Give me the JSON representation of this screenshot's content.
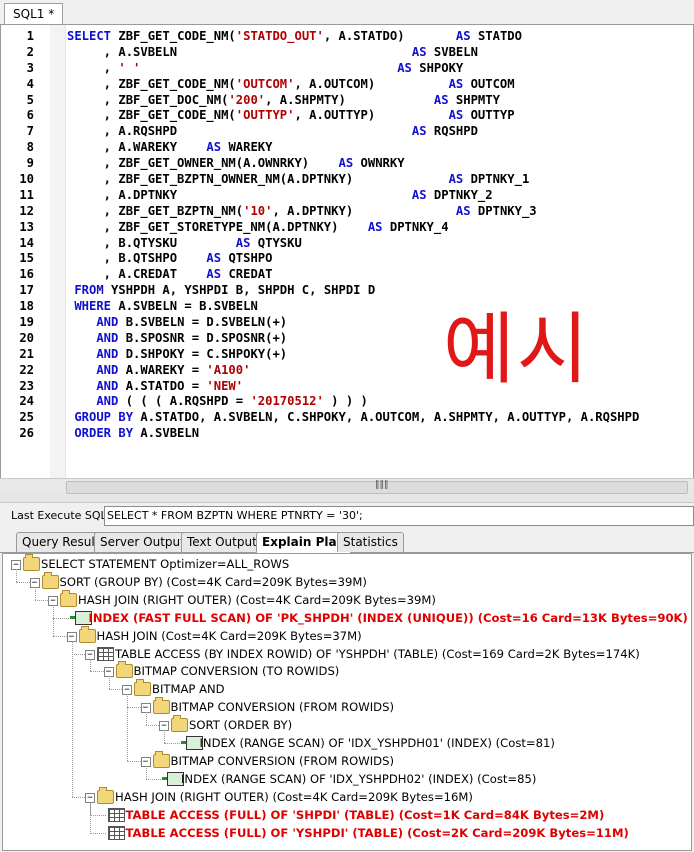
{
  "editor_tab": "SQL1 *",
  "code_lines": [
    [
      {
        "t": "SELECT ",
        "c": "kw"
      },
      {
        "t": "ZBF_GET_CODE_NM(",
        "c": "fn"
      },
      {
        "t": "'STATDO_OUT'",
        "c": "str"
      },
      {
        "t": ", A.STATDO)       ",
        "c": "fn"
      },
      {
        "t": "AS",
        "c": "kw"
      },
      {
        "t": " STATDO",
        "c": "fn"
      }
    ],
    [
      {
        "t": "     , A.SVBELN                                ",
        "c": "fn"
      },
      {
        "t": "AS",
        "c": "kw"
      },
      {
        "t": " SVBELN",
        "c": "fn"
      }
    ],
    [
      {
        "t": "     , ",
        "c": "fn"
      },
      {
        "t": "' '",
        "c": "str"
      },
      {
        "t": "                                   ",
        "c": "fn"
      },
      {
        "t": "AS",
        "c": "kw"
      },
      {
        "t": " SHPOKY",
        "c": "fn"
      }
    ],
    [
      {
        "t": "     , ZBF_GET_CODE_NM(",
        "c": "fn"
      },
      {
        "t": "'OUTCOM'",
        "c": "str"
      },
      {
        "t": ", A.OUTCOM)          ",
        "c": "fn"
      },
      {
        "t": "AS",
        "c": "kw"
      },
      {
        "t": " OUTCOM",
        "c": "fn"
      }
    ],
    [
      {
        "t": "     , ZBF_GET_DOC_NM(",
        "c": "fn"
      },
      {
        "t": "'200'",
        "c": "str"
      },
      {
        "t": ", A.SHPMTY)            ",
        "c": "fn"
      },
      {
        "t": "AS",
        "c": "kw"
      },
      {
        "t": " SHPMTY",
        "c": "fn"
      }
    ],
    [
      {
        "t": "     , ZBF_GET_CODE_NM(",
        "c": "fn"
      },
      {
        "t": "'OUTTYP'",
        "c": "str"
      },
      {
        "t": ", A.OUTTYP)          ",
        "c": "fn"
      },
      {
        "t": "AS",
        "c": "kw"
      },
      {
        "t": " OUTTYP",
        "c": "fn"
      }
    ],
    [
      {
        "t": "     , A.RQSHPD                                ",
        "c": "fn"
      },
      {
        "t": "AS",
        "c": "kw"
      },
      {
        "t": " RQSHPD",
        "c": "fn"
      }
    ],
    [
      {
        "t": "     , A.WAREKY    ",
        "c": "fn"
      },
      {
        "t": "AS",
        "c": "kw"
      },
      {
        "t": " WAREKY",
        "c": "fn"
      }
    ],
    [
      {
        "t": "     , ZBF_GET_OWNER_NM(A.OWNRKY)    ",
        "c": "fn"
      },
      {
        "t": "AS",
        "c": "kw"
      },
      {
        "t": " OWNRKY",
        "c": "fn"
      }
    ],
    [
      {
        "t": "     , ZBF_GET_BZPTN_OWNER_NM(A.DPTNKY)             ",
        "c": "fn"
      },
      {
        "t": "AS",
        "c": "kw"
      },
      {
        "t": " DPTNKY_1",
        "c": "fn"
      }
    ],
    [
      {
        "t": "     , A.DPTNKY                                ",
        "c": "fn"
      },
      {
        "t": "AS",
        "c": "kw"
      },
      {
        "t": " DPTNKY_2",
        "c": "fn"
      }
    ],
    [
      {
        "t": "     , ZBF_GET_BZPTN_NM(",
        "c": "fn"
      },
      {
        "t": "'10'",
        "c": "str"
      },
      {
        "t": ", A.DPTNKY)              ",
        "c": "fn"
      },
      {
        "t": "AS",
        "c": "kw"
      },
      {
        "t": " DPTNKY_3",
        "c": "fn"
      }
    ],
    [
      {
        "t": "     , ZBF_GET_STORETYPE_NM(A.DPTNKY)    ",
        "c": "fn"
      },
      {
        "t": "AS",
        "c": "kw"
      },
      {
        "t": " DPTNKY_4",
        "c": "fn"
      }
    ],
    [
      {
        "t": "     , B.QTYSKU        ",
        "c": "fn"
      },
      {
        "t": "AS",
        "c": "kw"
      },
      {
        "t": " QTYSKU",
        "c": "fn"
      }
    ],
    [
      {
        "t": "     , B.QTSHPO    ",
        "c": "fn"
      },
      {
        "t": "AS",
        "c": "kw"
      },
      {
        "t": " QTSHPO",
        "c": "fn"
      }
    ],
    [
      {
        "t": "     , A.CREDAT    ",
        "c": "fn"
      },
      {
        "t": "AS",
        "c": "kw"
      },
      {
        "t": " CREDAT",
        "c": "fn"
      }
    ],
    [
      {
        "t": " FROM ",
        "c": "kw"
      },
      {
        "t": "YSHPDH A, YSHPDI B, SHPDH C, SHPDI D",
        "c": "fn"
      }
    ],
    [
      {
        "t": " WHERE ",
        "c": "kw"
      },
      {
        "t": "A.SVBELN = B.SVBELN",
        "c": "fn"
      }
    ],
    [
      {
        "t": "    AND ",
        "c": "kw"
      },
      {
        "t": "B.SVBELN = D.SVBELN(+)",
        "c": "fn"
      }
    ],
    [
      {
        "t": "    AND ",
        "c": "kw"
      },
      {
        "t": "B.SPOSNR = D.SPOSNR(+)",
        "c": "fn"
      }
    ],
    [
      {
        "t": "    AND ",
        "c": "kw"
      },
      {
        "t": "D.SHPOKY = C.SHPOKY(+)",
        "c": "fn"
      }
    ],
    [
      {
        "t": "    AND ",
        "c": "kw"
      },
      {
        "t": "A.WAREKY = ",
        "c": "fn"
      },
      {
        "t": "'A100'",
        "c": "str"
      }
    ],
    [
      {
        "t": "    AND ",
        "c": "kw"
      },
      {
        "t": "A.STATDO = ",
        "c": "fn"
      },
      {
        "t": "'NEW'",
        "c": "str"
      }
    ],
    [
      {
        "t": "    AND ",
        "c": "kw"
      },
      {
        "t": "( ( ( A.RQSHPD = ",
        "c": "fn"
      },
      {
        "t": "'20170512'",
        "c": "str"
      },
      {
        "t": " ) ) )",
        "c": "fn"
      }
    ],
    [
      {
        "t": " GROUP BY ",
        "c": "kw"
      },
      {
        "t": "A.STATDO, A.SVBELN, C.SHPOKY, A.OUTCOM, A.SHPMTY, A.OUTTYP, A.RQSHPD",
        "c": "fn"
      }
    ],
    [
      {
        "t": " ORDER BY ",
        "c": "kw"
      },
      {
        "t": "A.SVBELN",
        "c": "fn"
      }
    ]
  ],
  "watermark": "예시",
  "last_sql_label": "Last Execute SQL:",
  "last_sql_value": "SELECT * FROM BZPTN WHERE PTNRTY = '30';",
  "result_tabs": [
    "Query Result",
    "Server Output",
    "Text Output",
    "Explain Plan",
    "Statistics"
  ],
  "active_tab": "Explain Plan",
  "plan_nodes": [
    {
      "depth": 0,
      "icon": "folder",
      "text": "SELECT STATEMENT Optimizer=ALL_ROWS",
      "red": false
    },
    {
      "depth": 1,
      "icon": "folder",
      "text": "SORT (GROUP BY) (Cost=4K Card=209K Bytes=39M)",
      "red": false
    },
    {
      "depth": 2,
      "icon": "folder",
      "text": "HASH JOIN (RIGHT OUTER) (Cost=4K Card=209K Bytes=39M)",
      "red": false
    },
    {
      "depth": 3,
      "icon": "index",
      "text": "INDEX (FAST FULL SCAN) OF 'PK_SHPDH' (INDEX (UNIQUE)) (Cost=16 Card=13K Bytes=90K)",
      "red": true
    },
    {
      "depth": 3,
      "icon": "folder",
      "text": "HASH JOIN (Cost=4K Card=209K Bytes=37M)",
      "red": false
    },
    {
      "depth": 4,
      "icon": "table",
      "text": "TABLE ACCESS (BY INDEX ROWID) OF 'YSHPDH' (TABLE) (Cost=169 Card=2K Bytes=174K)",
      "red": false
    },
    {
      "depth": 5,
      "icon": "folder",
      "text": "BITMAP CONVERSION (TO ROWIDS)",
      "red": false
    },
    {
      "depth": 6,
      "icon": "folder",
      "text": "BITMAP AND",
      "red": false
    },
    {
      "depth": 7,
      "icon": "folder",
      "text": "BITMAP CONVERSION (FROM ROWIDS)",
      "red": false
    },
    {
      "depth": 8,
      "icon": "folder",
      "text": "SORT (ORDER BY)",
      "red": false
    },
    {
      "depth": 9,
      "icon": "index",
      "text": "INDEX (RANGE SCAN) OF 'IDX_YSHPDH01' (INDEX) (Cost=81)",
      "red": false
    },
    {
      "depth": 7,
      "icon": "folder",
      "text": "BITMAP CONVERSION (FROM ROWIDS)",
      "red": false
    },
    {
      "depth": 8,
      "icon": "index",
      "text": "INDEX (RANGE SCAN) OF 'IDX_YSHPDH02' (INDEX) (Cost=85)",
      "red": false
    },
    {
      "depth": 4,
      "icon": "folder",
      "text": "HASH JOIN (RIGHT OUTER) (Cost=4K Card=209K Bytes=16M)",
      "red": false
    },
    {
      "depth": 5,
      "icon": "table",
      "text": "TABLE ACCESS (FULL) OF 'SHPDI' (TABLE) (Cost=1K Card=84K Bytes=2M)",
      "red": true
    },
    {
      "depth": 5,
      "icon": "table",
      "text": "TABLE ACCESS (FULL) OF 'YSHPDI' (TABLE) (Cost=2K Card=209K Bytes=11M)",
      "red": true
    }
  ],
  "colors": {
    "keyword": "#1010d0",
    "string": "#b00000",
    "highlight": "#e00000"
  }
}
